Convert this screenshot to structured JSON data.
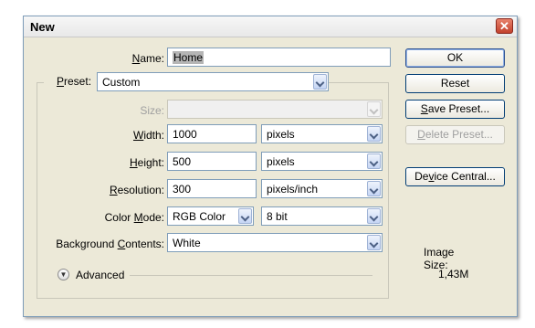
{
  "dialog": {
    "title": "New",
    "close_glyph": "✕"
  },
  "form": {
    "name": {
      "label": "Name:",
      "accel": "N",
      "rest": "ame:",
      "value": "Home"
    },
    "preset": {
      "accel": "P",
      "rest": "reset:",
      "value": "Custom"
    },
    "size": {
      "label": "Size:",
      "value": ""
    },
    "width": {
      "accel": "W",
      "rest": "idth:",
      "value": "1000",
      "unit": "pixels"
    },
    "height": {
      "accel": "H",
      "rest": "eight:",
      "value": "500",
      "unit": "pixels"
    },
    "resolution": {
      "accel": "R",
      "rest": "esolution:",
      "value": "300",
      "unit": "pixels/inch"
    },
    "color_mode": {
      "prefix": "Color ",
      "accel": "M",
      "rest": "ode:",
      "value": "RGB Color",
      "depth": "8 bit"
    },
    "background": {
      "prefix": "Background ",
      "accel": "C",
      "rest": "ontents:",
      "value": "White"
    },
    "advanced": {
      "label": "Advanced",
      "icon": "chevron-double-down"
    }
  },
  "buttons": {
    "ok": "OK",
    "reset": "Reset",
    "save_preset_accel": "S",
    "save_preset_rest": "ave Preset...",
    "delete_preset_accel": "D",
    "delete_preset_rest": "elete Preset...",
    "device_central_accel": "v",
    "device_central_pre": "De",
    "device_central_rest": "ice Central..."
  },
  "image_size": {
    "label": "Image Size:",
    "value": "1,43M"
  }
}
